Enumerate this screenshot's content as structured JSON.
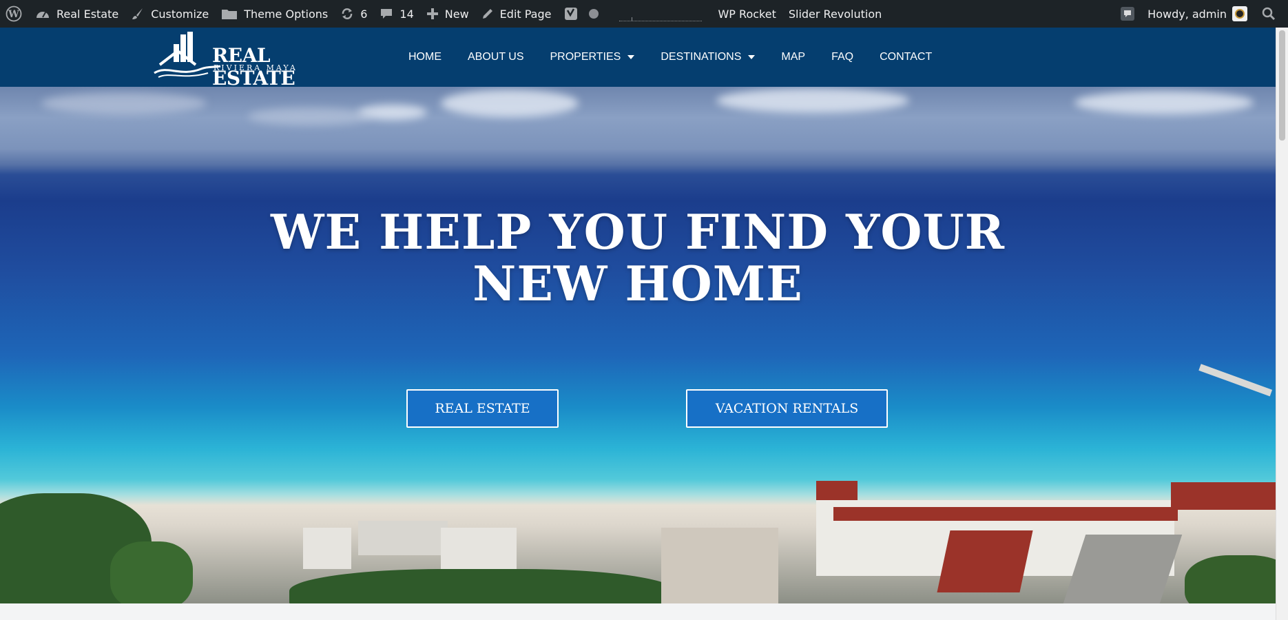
{
  "admin_bar": {
    "site_name": "Real Estate",
    "customize": "Customize",
    "theme_options": "Theme Options",
    "updates_count": "6",
    "comments_count": "14",
    "new_label": "New",
    "edit_page": "Edit Page",
    "wp_rocket": "WP Rocket",
    "slider_revolution": "Slider Revolution",
    "howdy": "Howdy, admin"
  },
  "header": {
    "logo_text": "REAL ESTATE",
    "logo_subtext": "RIVIERA MAYA",
    "nav": {
      "home": "HOME",
      "about": "ABOUT US",
      "properties": "PROPERTIES",
      "destinations": "DESTINATIONS",
      "map": "MAP",
      "faq": "FAQ",
      "contact": "CONTACT"
    }
  },
  "hero": {
    "title_line1": "WE HELP YOU FIND YOUR",
    "title_line2": "NEW HOME",
    "button_real_estate": "REAL ESTATE",
    "button_vacation": "VACATION RENTALS"
  },
  "colors": {
    "admin_bar": "#1d2327",
    "header_bg": "#053e6f",
    "button_bg": "#1770c6"
  }
}
